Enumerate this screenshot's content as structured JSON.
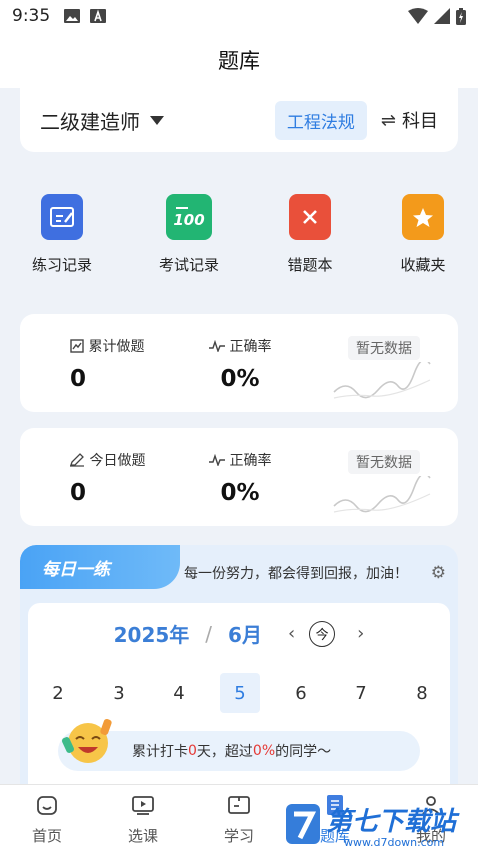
{
  "status": {
    "time": "9:35"
  },
  "appbar": {
    "title": "题库"
  },
  "exam": {
    "name": "二级建造师",
    "subject": "工程法规",
    "switch_label": "科目"
  },
  "quick": [
    {
      "label": "练习记录",
      "icon": "practice-record-icon",
      "color": "#3f6fe0"
    },
    {
      "label": "考试记录",
      "icon": "exam-record-icon",
      "color": "#22b573"
    },
    {
      "label": "错题本",
      "icon": "wrong-book-icon",
      "color": "#e9503a"
    },
    {
      "label": "收藏夹",
      "icon": "favorites-icon",
      "color": "#f39a1b"
    }
  ],
  "stats_total": {
    "done_label": "累计做题",
    "done_value": "0",
    "rate_label": "正确率",
    "rate_value": "0%",
    "nodata": "暂无数据"
  },
  "stats_today": {
    "done_label": "今日做题",
    "done_value": "0",
    "rate_label": "正确率",
    "rate_value": "0%",
    "nodata": "暂无数据"
  },
  "daily": {
    "tag": "每日一练",
    "motto": "每一份努力，都会得到回报，加油！",
    "year": "2025年",
    "sep": "/",
    "month": "6月",
    "prev": "‹",
    "next": "›",
    "today": "今",
    "days": [
      "2",
      "3",
      "4",
      "5",
      "6",
      "7",
      "8"
    ],
    "selected_day": "5",
    "streak": {
      "p1": "累计打卡",
      "days": "0",
      "p2": "天，超过",
      "pct": "0%",
      "p3": "的同学～"
    }
  },
  "tabs": [
    {
      "label": "首页",
      "icon": "home-icon"
    },
    {
      "label": "选课",
      "icon": "course-icon"
    },
    {
      "label": "学习",
      "icon": "study-icon"
    },
    {
      "label": "题库",
      "icon": "question-bank-icon"
    },
    {
      "label": "我的",
      "icon": "profile-icon"
    }
  ],
  "watermark": {
    "text": "第七下载站",
    "url": "www.d7down.com"
  }
}
